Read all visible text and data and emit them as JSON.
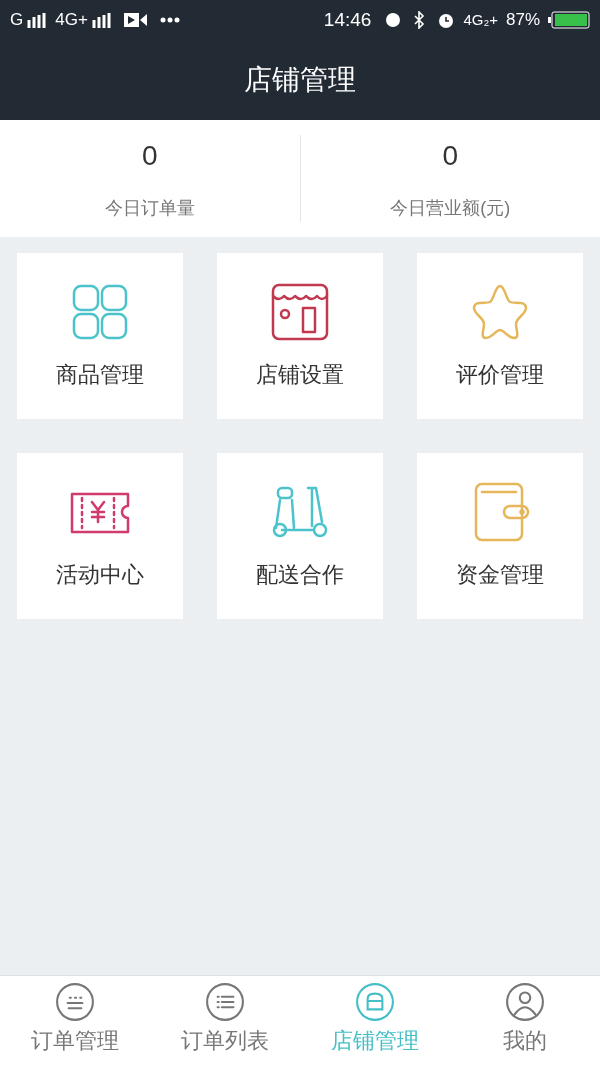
{
  "status_bar": {
    "left": [
      "G",
      "4G+"
    ],
    "time": "14:46",
    "network": "4G₂+",
    "battery": "87%"
  },
  "header": {
    "title": "店铺管理"
  },
  "stats": [
    {
      "value": "0",
      "label": "今日订单量"
    },
    {
      "value": "0",
      "label": "今日营业额(元)"
    }
  ],
  "tiles": [
    {
      "kind": "grid",
      "label": "商品管理",
      "color": "#4cc3cb"
    },
    {
      "kind": "shop",
      "label": "店铺设置",
      "color": "#c0394f"
    },
    {
      "kind": "star",
      "label": "评价管理",
      "color": "#e5b75a"
    },
    {
      "kind": "ticket",
      "label": "活动中心",
      "color": "#d13a6c"
    },
    {
      "kind": "scooter",
      "label": "配送合作",
      "color": "#4cc3cb"
    },
    {
      "kind": "wallet",
      "label": "资金管理",
      "color": "#e5b75a"
    }
  ],
  "tab_bar": [
    {
      "kind": "orders",
      "label": "订单管理",
      "selected": false
    },
    {
      "kind": "list",
      "label": "订单列表",
      "selected": false
    },
    {
      "kind": "shop",
      "label": "店铺管理",
      "selected": true
    },
    {
      "kind": "user",
      "label": "我的",
      "selected": false
    }
  ]
}
